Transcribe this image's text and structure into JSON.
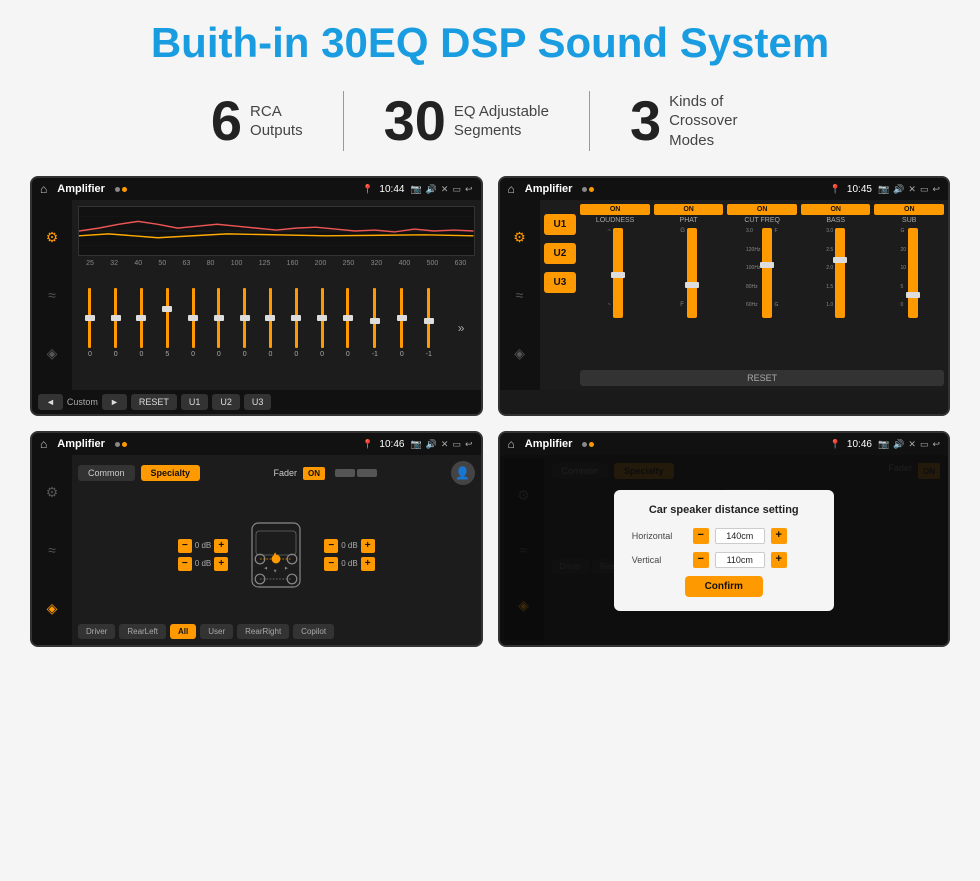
{
  "page": {
    "title": "Buith-in 30EQ DSP Sound System",
    "stats": [
      {
        "number": "6",
        "text": "RCA\nOutputs"
      },
      {
        "number": "30",
        "text": "EQ Adjustable\nSegments"
      },
      {
        "number": "3",
        "text": "Kinds of\nCrossover Modes"
      }
    ]
  },
  "screen1": {
    "status": {
      "appName": "Amplifier",
      "time": "10:44"
    },
    "eq_freqs": [
      "25",
      "32",
      "40",
      "50",
      "63",
      "80",
      "100",
      "125",
      "160",
      "200",
      "250",
      "320",
      "400",
      "500",
      "630"
    ],
    "eq_values": [
      "0",
      "0",
      "0",
      "5",
      "0",
      "0",
      "0",
      "0",
      "0",
      "0",
      "0",
      "-1",
      "0",
      "-1"
    ],
    "buttons": [
      "Custom",
      "RESET",
      "U1",
      "U2",
      "U3"
    ]
  },
  "screen2": {
    "status": {
      "appName": "Amplifier",
      "time": "10:45"
    },
    "u_buttons": [
      "U1",
      "U2",
      "U3"
    ],
    "channels": [
      {
        "label": "LOUDNESS",
        "on": true
      },
      {
        "label": "PHAT",
        "on": true
      },
      {
        "label": "CUT FREQ",
        "on": true
      },
      {
        "label": "BASS",
        "on": true
      },
      {
        "label": "SUB",
        "on": true
      }
    ],
    "reset": "RESET"
  },
  "screen3": {
    "status": {
      "appName": "Amplifier",
      "time": "10:46"
    },
    "tabs": [
      "Common",
      "Specialty"
    ],
    "fader_label": "Fader",
    "on_label": "ON",
    "db_controls": [
      "0 dB",
      "0 dB",
      "0 dB",
      "0 dB"
    ],
    "bottom_labels": [
      "Driver",
      "RearLeft",
      "All",
      "User",
      "RearRight",
      "Copilot"
    ]
  },
  "screen4": {
    "status": {
      "appName": "Amplifier",
      "time": "10:46"
    },
    "tabs": [
      "Common",
      "Specialty"
    ],
    "dialog": {
      "title": "Car speaker distance setting",
      "horizontal_label": "Horizontal",
      "horizontal_value": "140cm",
      "vertical_label": "Vertical",
      "vertical_value": "110cm",
      "confirm_label": "Confirm"
    },
    "bottom_labels": [
      "Driver",
      "RearLeft",
      "All",
      "User",
      "RearRight",
      "Copilot"
    ]
  }
}
